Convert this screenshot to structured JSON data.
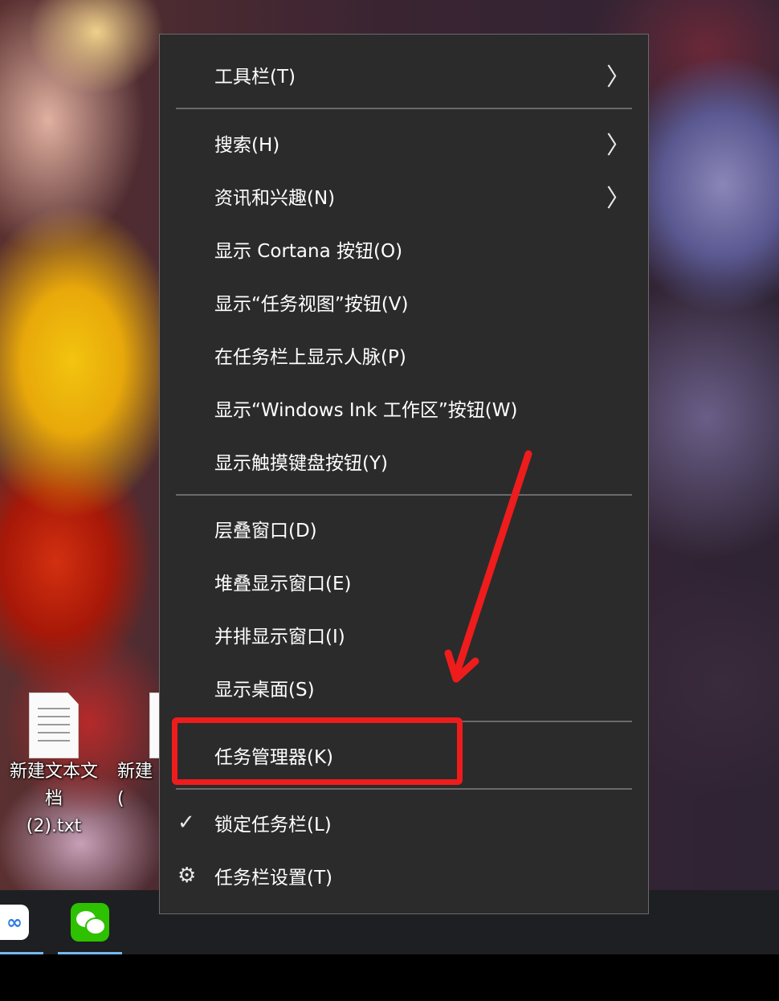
{
  "menu": {
    "items": [
      {
        "label": "工具栏(T)",
        "submenu": true
      },
      {
        "label": "搜索(H)",
        "submenu": true
      },
      {
        "label": "资讯和兴趣(N)",
        "submenu": true
      },
      {
        "label": "显示 Cortana 按钮(O)"
      },
      {
        "label": "显示“任务视图”按钮(V)"
      },
      {
        "label": "在任务栏上显示人脉(P)"
      },
      {
        "label": "显示“Windows Ink 工作区”按钮(W)"
      },
      {
        "label": "显示触摸键盘按钮(Y)"
      },
      {
        "label": "层叠窗口(D)"
      },
      {
        "label": "堆叠显示窗口(E)"
      },
      {
        "label": "并排显示窗口(I)"
      },
      {
        "label": "显示桌面(S)"
      },
      {
        "label": "任务管理器(K)",
        "highlighted": true
      },
      {
        "label": "锁定任务栏(L)",
        "checked": true
      },
      {
        "label": "任务栏设置(T)",
        "icon": "gear-icon"
      }
    ],
    "chevron": "〉",
    "check_glyph": "✓",
    "gear_glyph": "⚙"
  },
  "desktop": {
    "icons": [
      {
        "label": "新建文本文档\n(2).txt"
      },
      {
        "label": "新建\n("
      }
    ]
  },
  "taskbar": {
    "apps": [
      {
        "name": "baidu-netdisk",
        "glyph": "∞"
      },
      {
        "name": "wechat"
      }
    ]
  },
  "colors": {
    "menu_bg": "#2b2b2b",
    "separator": "#6a6a6a",
    "annotation": "#ee1c1c",
    "taskbar_indicator": "#76b9ed"
  }
}
